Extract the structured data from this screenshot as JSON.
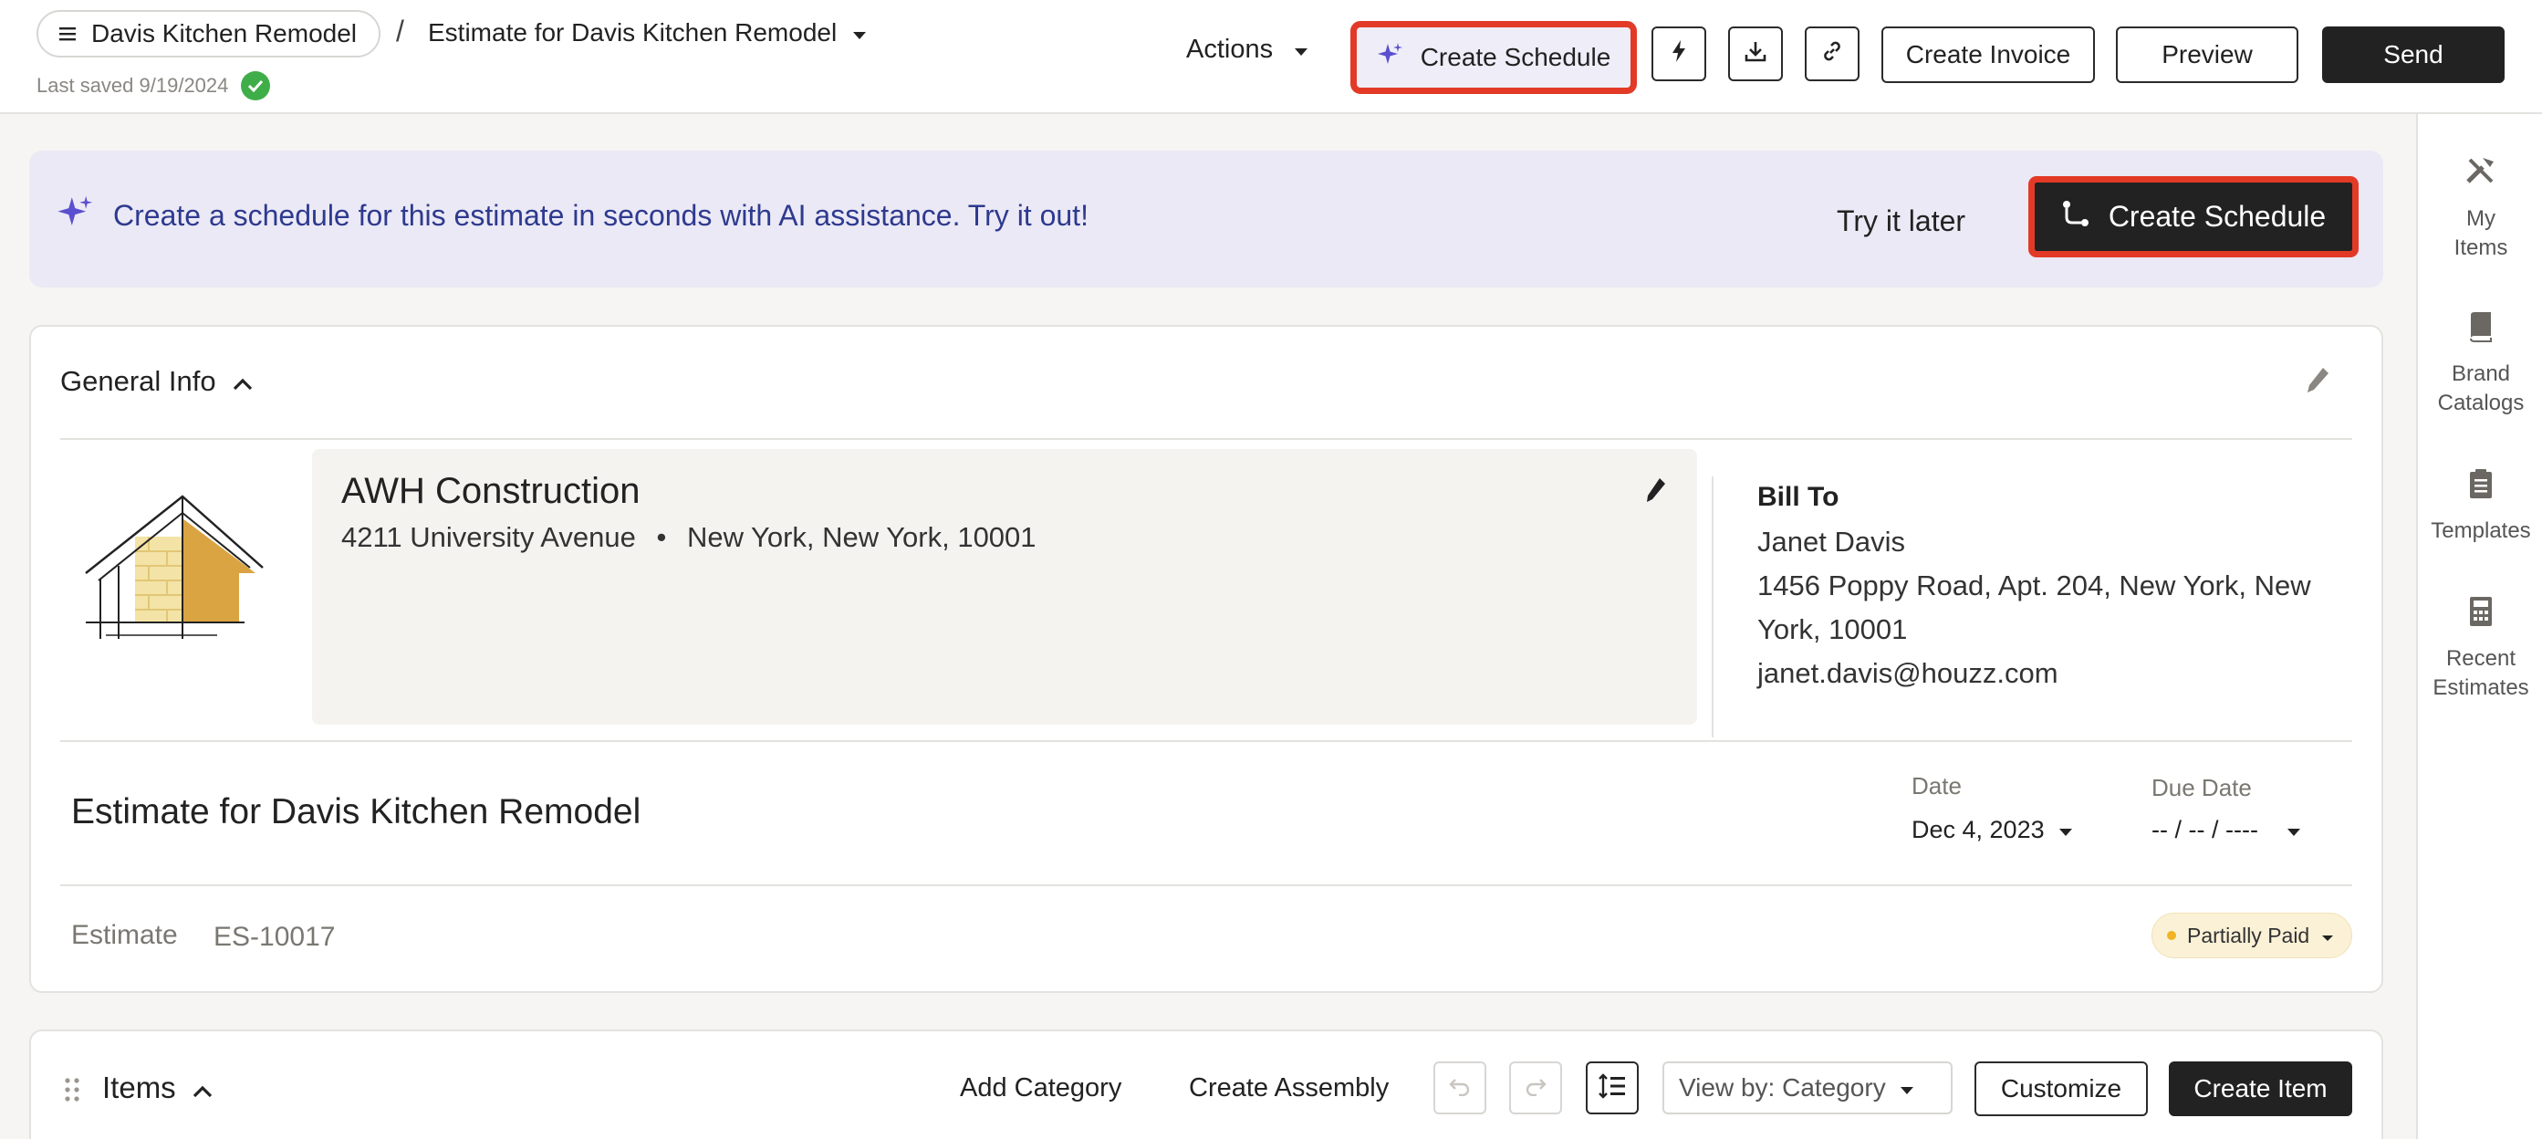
{
  "header": {
    "project_name": "Davis Kitchen Remodel",
    "separator": "/",
    "estimate_name": "Estimate for Davis Kitchen Remodel",
    "last_saved": "Last saved 9/19/2024",
    "actions_label": "Actions",
    "create_schedule_label": "Create Schedule",
    "create_invoice_label": "Create Invoice",
    "preview_label": "Preview",
    "send_label": "Send"
  },
  "banner": {
    "message": "Create a schedule for this estimate in seconds with AI assistance. Try it out!",
    "try_later_label": "Try it later",
    "create_schedule_label": "Create Schedule"
  },
  "general_info": {
    "title": "General Info",
    "company": {
      "name": "AWH Construction",
      "street": "4211 University Avenue",
      "bullet": "•",
      "city": "New York, New York, 10001"
    },
    "bill_to": {
      "label": "Bill To",
      "name": "Janet Davis",
      "address_line1": "1456 Poppy Road, Apt. 204, New York, New",
      "address_line2": "York, 10001",
      "email": "janet.davis@houzz.com"
    },
    "estimate_title": "Estimate for Davis Kitchen Remodel",
    "date_label": "Date",
    "date_value": "Dec 4, 2023",
    "due_date_label": "Due Date",
    "due_date_value": "-- / -- / ----",
    "estimate_label": "Estimate",
    "estimate_number": "ES-10017",
    "status": "Partially Paid"
  },
  "items": {
    "title": "Items",
    "add_category_label": "Add Category",
    "create_assembly_label": "Create Assembly",
    "view_by_label": "View by: Category",
    "customize_label": "Customize",
    "create_item_label": "Create Item"
  },
  "siderail": {
    "my_items": [
      "My",
      "Items"
    ],
    "brand_catalogs": [
      "Brand",
      "Catalogs"
    ],
    "templates": [
      "Templates"
    ],
    "recent_estimates": [
      "Recent",
      "Estimates"
    ]
  },
  "colors": {
    "highlight": "#e23a26",
    "banner_bg": "#ebe9f5",
    "banner_text": "#2e3a8f",
    "dark_button": "#222222",
    "status_bg": "#fbf1d6",
    "logo_gold": "#d9a441"
  }
}
